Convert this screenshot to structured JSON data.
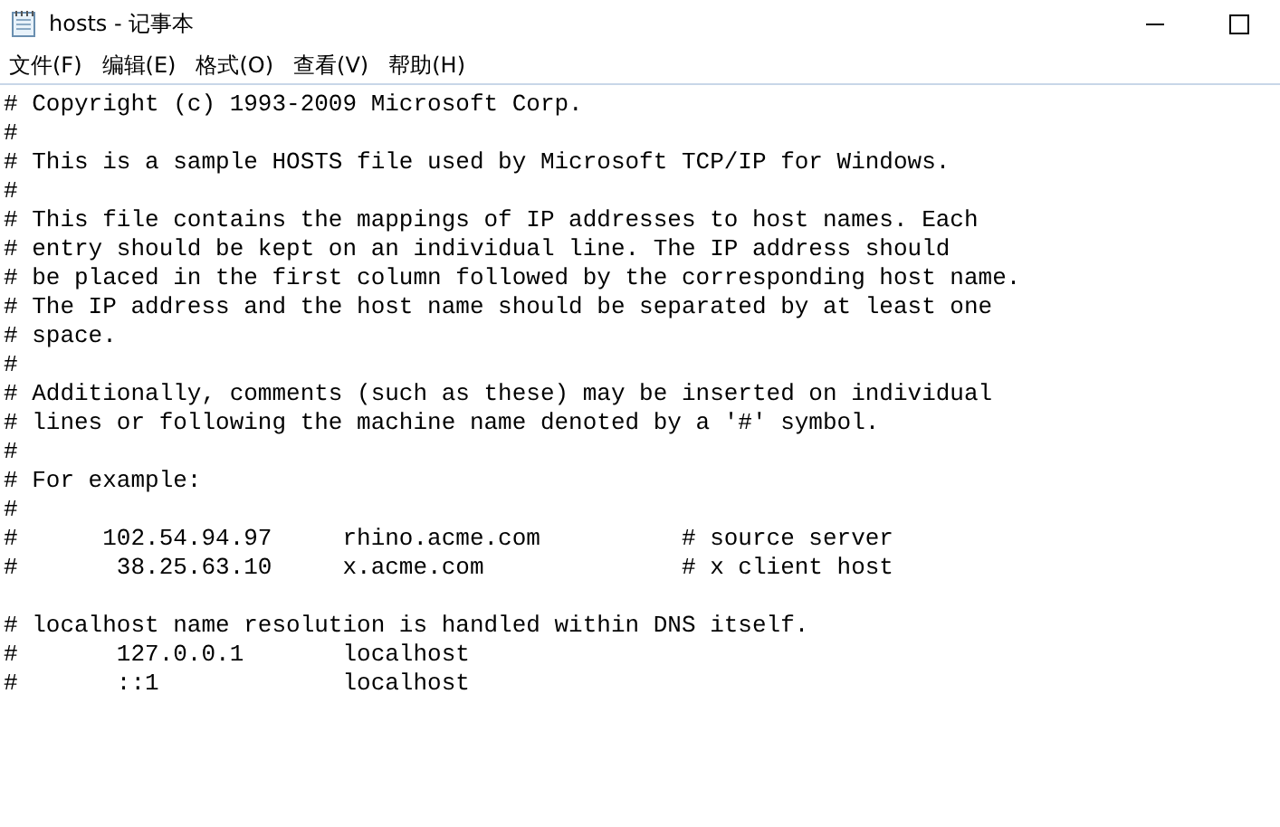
{
  "window": {
    "title": "hosts - 记事本"
  },
  "menu": [
    "文件(F)",
    "编辑(E)",
    "格式(O)",
    "查看(V)",
    "帮助(H)"
  ],
  "editor": {
    "blocks": [
      [
        "# Copyright (c) 1993-2009 Microsoft Corp.",
        "#",
        "# This is a sample HOSTS file used by Microsoft TCP/IP for Windows.",
        "#",
        "# This file contains the mappings of IP addresses to host names. Each",
        "# entry should be kept on an individual line. The IP address should",
        "# be placed in the first column followed by the corresponding host name.",
        "# The IP address and the host name should be separated by at least one",
        "# space.",
        "#",
        "# Additionally, comments (such as these) may be inserted on individual",
        "# lines or following the machine name denoted by a '#' symbol.",
        "#",
        "# For example:",
        "#",
        "#      102.54.94.97     rhino.acme.com          # source server",
        "#       38.25.63.10     x.acme.com              # x client host"
      ],
      [
        "# localhost name resolution is handled within DNS itself.",
        "#       127.0.0.1       localhost",
        "#       ::1             localhost"
      ]
    ]
  }
}
